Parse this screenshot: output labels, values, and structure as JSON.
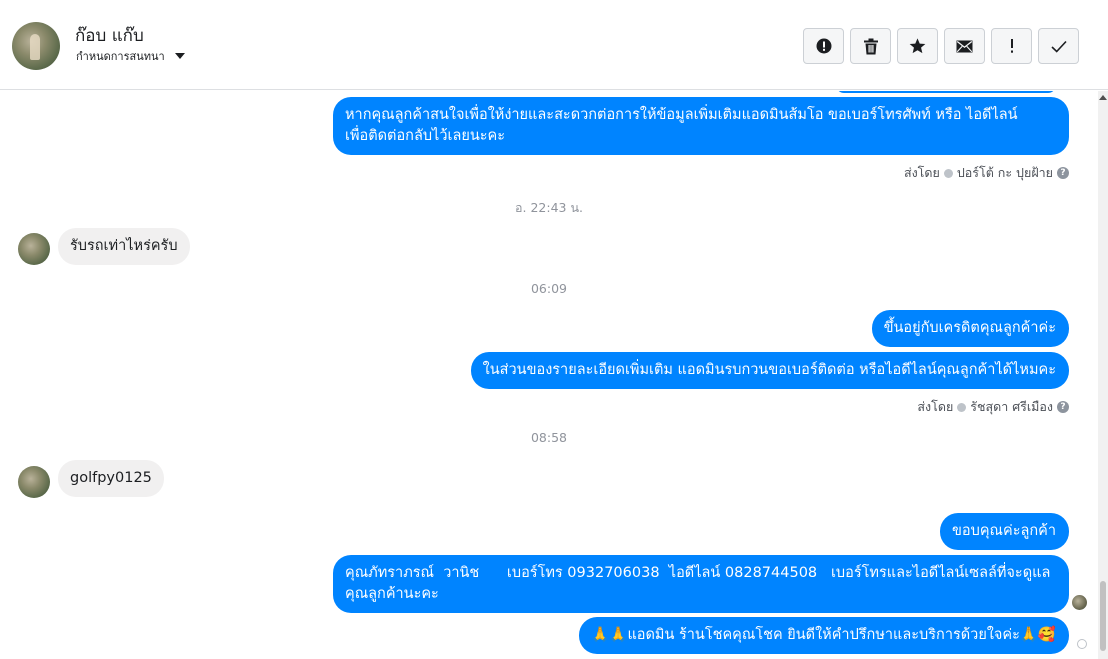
{
  "header": {
    "contact_name": "ก๊อบ แก๊บ",
    "assign_label": "กำหนดการสนทนา",
    "toolbar": [
      {
        "name": "spam-button",
        "icon": "alert-circle-icon"
      },
      {
        "name": "delete-button",
        "icon": "trash-icon"
      },
      {
        "name": "star-button",
        "icon": "star-icon"
      },
      {
        "name": "mark-unread-button",
        "icon": "envelope-icon"
      },
      {
        "name": "follow-up-button",
        "icon": "exclamation-icon"
      },
      {
        "name": "mark-done-button",
        "icon": "checkmark-icon"
      }
    ]
  },
  "thread": {
    "msg1": "หากคุณลูกค้าสนใจเพื่อให้ง่ายและสะดวกต่อการให้ข้อมูลเพิ่มเติมแอดมินส้มโอ ขอเบอร์โทรศัพท์ หรือ ไอดีไลน์\nเพื่อติดต่อกลับไว้เลยนะคะ",
    "sent_by_1_label": "ส่งโดย",
    "sent_by_1_name": "ปอร์โต้ กะ ปุยฝ้าย",
    "time_1": "อ. 22:43 น.",
    "msg2": "รับรถเท่าไหร่ครับ",
    "time_2": "06:09",
    "msg3": "ขึ้นอยู่กับเครดิตคุณลูกค้าค่ะ",
    "msg4": "ในส่วนของรายละเอียดเพิ่มเติม แอดมินรบกวนขอเบอร์ติดต่อ หรือไอดีไลน์คุณลูกค้าได้ไหมคะ",
    "sent_by_2_label": "ส่งโดย",
    "sent_by_2_name": "รัชสุดา ศรีเมือง",
    "time_3": "08:58",
    "msg5": "golfpy0125",
    "msg6": "ขอบคุณค่ะลูกค้า",
    "msg7": "คุณภัทราภรณ์  วานิช      เบอร์โทร 0932706038  ไอดีไลน์ 0828744508   เบอร์โทรและไอดีไลน์เซลล์ที่จะดูแล\nคุณลูกค้านะคะ",
    "msg8": "🙏🙏แอดมิน ร้านโชคคุณโชค ยินดีให้คำปรึกษาและบริการด้วยใจค่ะ🙏🥰"
  },
  "colors": {
    "outgoing_bubble": "#0084ff",
    "incoming_bubble": "#f1f0f0",
    "timestamp": "#90949c"
  }
}
